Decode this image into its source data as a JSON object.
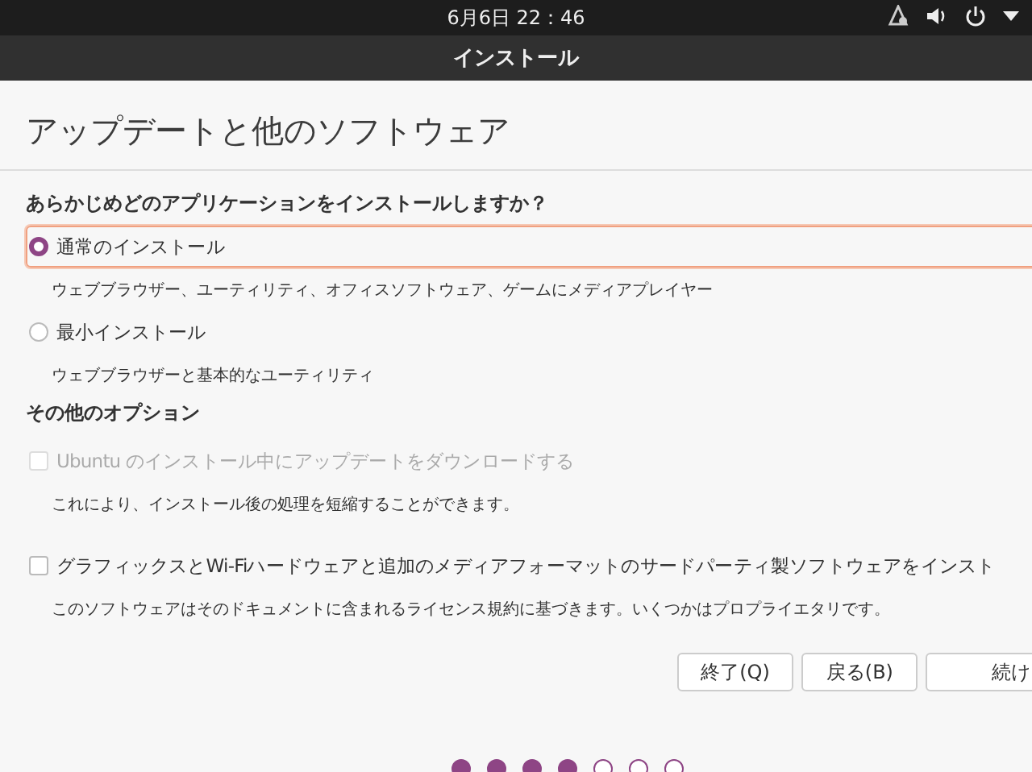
{
  "top_bar": {
    "clock": "6月6日 22：46"
  },
  "title_bar": {
    "title": "インストール"
  },
  "heading": "アップデートと他のソフトウェア",
  "install_type": {
    "question": "あらかじめどのアプリケーションをインストールしますか？",
    "options": [
      {
        "label": "通常のインストール",
        "description": "ウェブブラウザー、ユーティリティ、オフィスソフトウェア、ゲームにメディアプレイヤー",
        "selected": true,
        "focused": true
      },
      {
        "label": "最小インストール",
        "description": "ウェブブラウザーと基本的なユーティリティ",
        "selected": false,
        "focused": false
      }
    ]
  },
  "other_options": {
    "title": "その他のオプション",
    "options": [
      {
        "label": "Ubuntu のインストール中にアップデートをダウンロードする",
        "description": "これにより、インストール後の処理を短縮することができます。",
        "checked": false,
        "disabled": true
      },
      {
        "label": "グラフィックスとWi-Fiハードウェアと追加のメディアフォーマットのサードパーティ製ソフトウェアをインスト",
        "description": "このソフトウェアはそのドキュメントに含まれるライセンス規約に基づきます。いくつかはプロプライエタリです。",
        "checked": false,
        "disabled": false
      }
    ]
  },
  "buttons": [
    {
      "label": "終了(Q)"
    },
    {
      "label": "戻る(B)"
    },
    {
      "label": "続け"
    }
  ],
  "steps": [
    {
      "done": true
    },
    {
      "done": true
    },
    {
      "done": true
    },
    {
      "done": true
    },
    {
      "done": false
    },
    {
      "done": false
    },
    {
      "done": false
    }
  ]
}
